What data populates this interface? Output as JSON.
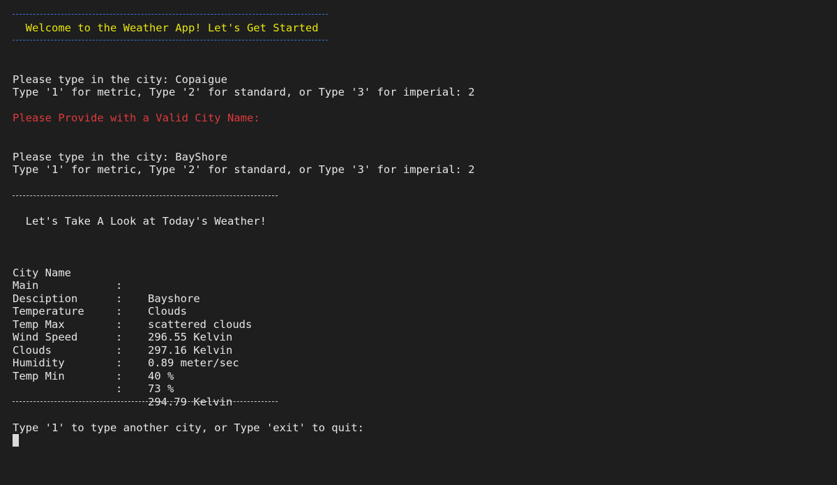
{
  "banner": {
    "title": "  Welcome to the Weather App! Let's Get Started"
  },
  "session": {
    "prompt1_city": "Please type in the city: Copaigue",
    "prompt1_units": "Type '1' for metric, Type '2' for standard, or Type '3' for imperial: 2",
    "error": "Please Provide with a Valid City Name:",
    "prompt2_city": "Please type in the city: BayShore",
    "prompt2_units": "Type '1' for metric, Type '2' for standard, or Type '3' for imperial: 2",
    "heading": "  Let's Take A Look at Today's Weather!"
  },
  "weather": {
    "separator": ":",
    "rows": [
      {
        "key": "City Name",
        "value": "Bayshore"
      },
      {
        "key": "Main",
        "value": "Clouds"
      },
      {
        "key": "Desciption",
        "value": "scattered clouds"
      },
      {
        "key": "Temperature",
        "value": "296.55 Kelvin"
      },
      {
        "key": "Temp Max",
        "value": "297.16 Kelvin"
      },
      {
        "key": "Wind Speed",
        "value": "0.89 meter/sec"
      },
      {
        "key": "Clouds",
        "value": "40 %"
      },
      {
        "key": "Humidity",
        "value": "73 %"
      },
      {
        "key": "Temp Min",
        "value": "294.79 Kelvin"
      }
    ]
  },
  "footer": {
    "prompt": "Type '1' to type another city, or Type 'exit' to quit:"
  },
  "colors": {
    "background": "#1e1e1e",
    "text": "#e6e6e6",
    "banner_text": "#e5e510",
    "banner_rule": "#3b74d4",
    "error": "#e0393c"
  }
}
